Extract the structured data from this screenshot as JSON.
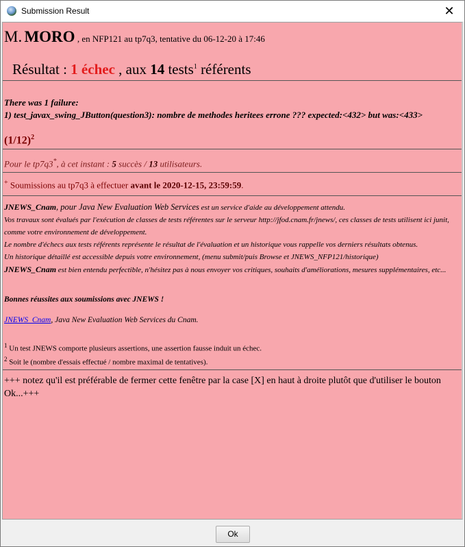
{
  "window": {
    "title": "Submission Result",
    "close_glyph": "✕",
    "icon": "java-cup-globe-icon"
  },
  "header": {
    "salutation": "M.",
    "surname": "MORO",
    "context": ", en NFP121 au tp7q3, tentative du 06-12-20 à 17:46"
  },
  "result": {
    "prefix": "Résultat :",
    "fail_count": "1 échec",
    "middle": ", aux",
    "test_count": "14",
    "tests_word": "tests",
    "sup": "1",
    "suffix": "référents"
  },
  "failure": {
    "line1": "There was 1 failure:",
    "line2": "1) test_javax_swing_JButton(question3): nombre de methodes heritees errone ??? expected:<432> but was:<433>"
  },
  "score": {
    "text": "(1/12)",
    "sup": "2"
  },
  "stats": {
    "prefix": "Pour le tp7q3",
    "sup": "*",
    "middle": ", à cet instant :",
    "success": "5",
    "success_word": "succès /",
    "users": "13",
    "users_word": "utilisateurs."
  },
  "deadline": {
    "sup": "+",
    "prefix": "Soumissions au tp7q3 à effectuer",
    "bold": "avant le 2020-12-15, 23:59:59",
    "suffix": "."
  },
  "info": {
    "brand": "JNEWS_Cnam",
    "brand_desc": ", pour Java New Evaluation Web Services",
    "brand_rest": "est un service d'aide au développement attendu.",
    "line2": "Vos travaux sont évalués par l'exécution de classes de tests référentes sur le serveur http://jfod.cnam.fr/jnews/, ces classes de tests utilisent ici junit, comme votre environnement de développement.",
    "line3": "Le nombre d'échecs aux tests référents représente le résultat de l'évaluation et un historique vous rappelle vos derniers résultats obtenus.",
    "line4": "Un historique détaillé est accessible depuis votre environnement, (menu submit/puis Browse et JNEWS_NFP121/historique)",
    "brand2": "JNEWS_Cnam",
    "line5": "est bien entendu perfectible, n'hésitez pas à nous envoyer vos critiques, souhaits d'améliorations, mesures supplémentaires, etc..."
  },
  "goodluck": "Bonnes réussites aux soumissions avec JNEWS !",
  "link": {
    "label": "JNEWS_Cnam",
    "rest": ", Java New Evaluation Web Services du Cnam."
  },
  "footnotes": [
    {
      "sup": "1",
      "text": "Un test JNEWS comporte plusieurs assertions, une assertion fausse induit un échec."
    },
    {
      "sup": "2",
      "text": "Soit le (nombre d'essais effectué / nombre maximal de tentatives)."
    }
  ],
  "footer_note": "+++ notez qu'il est préférable de fermer cette fenêtre par la case [X] en haut à droite plutôt que d'utiliser le bouton Ok...+++",
  "buttons": {
    "ok": "Ok"
  }
}
